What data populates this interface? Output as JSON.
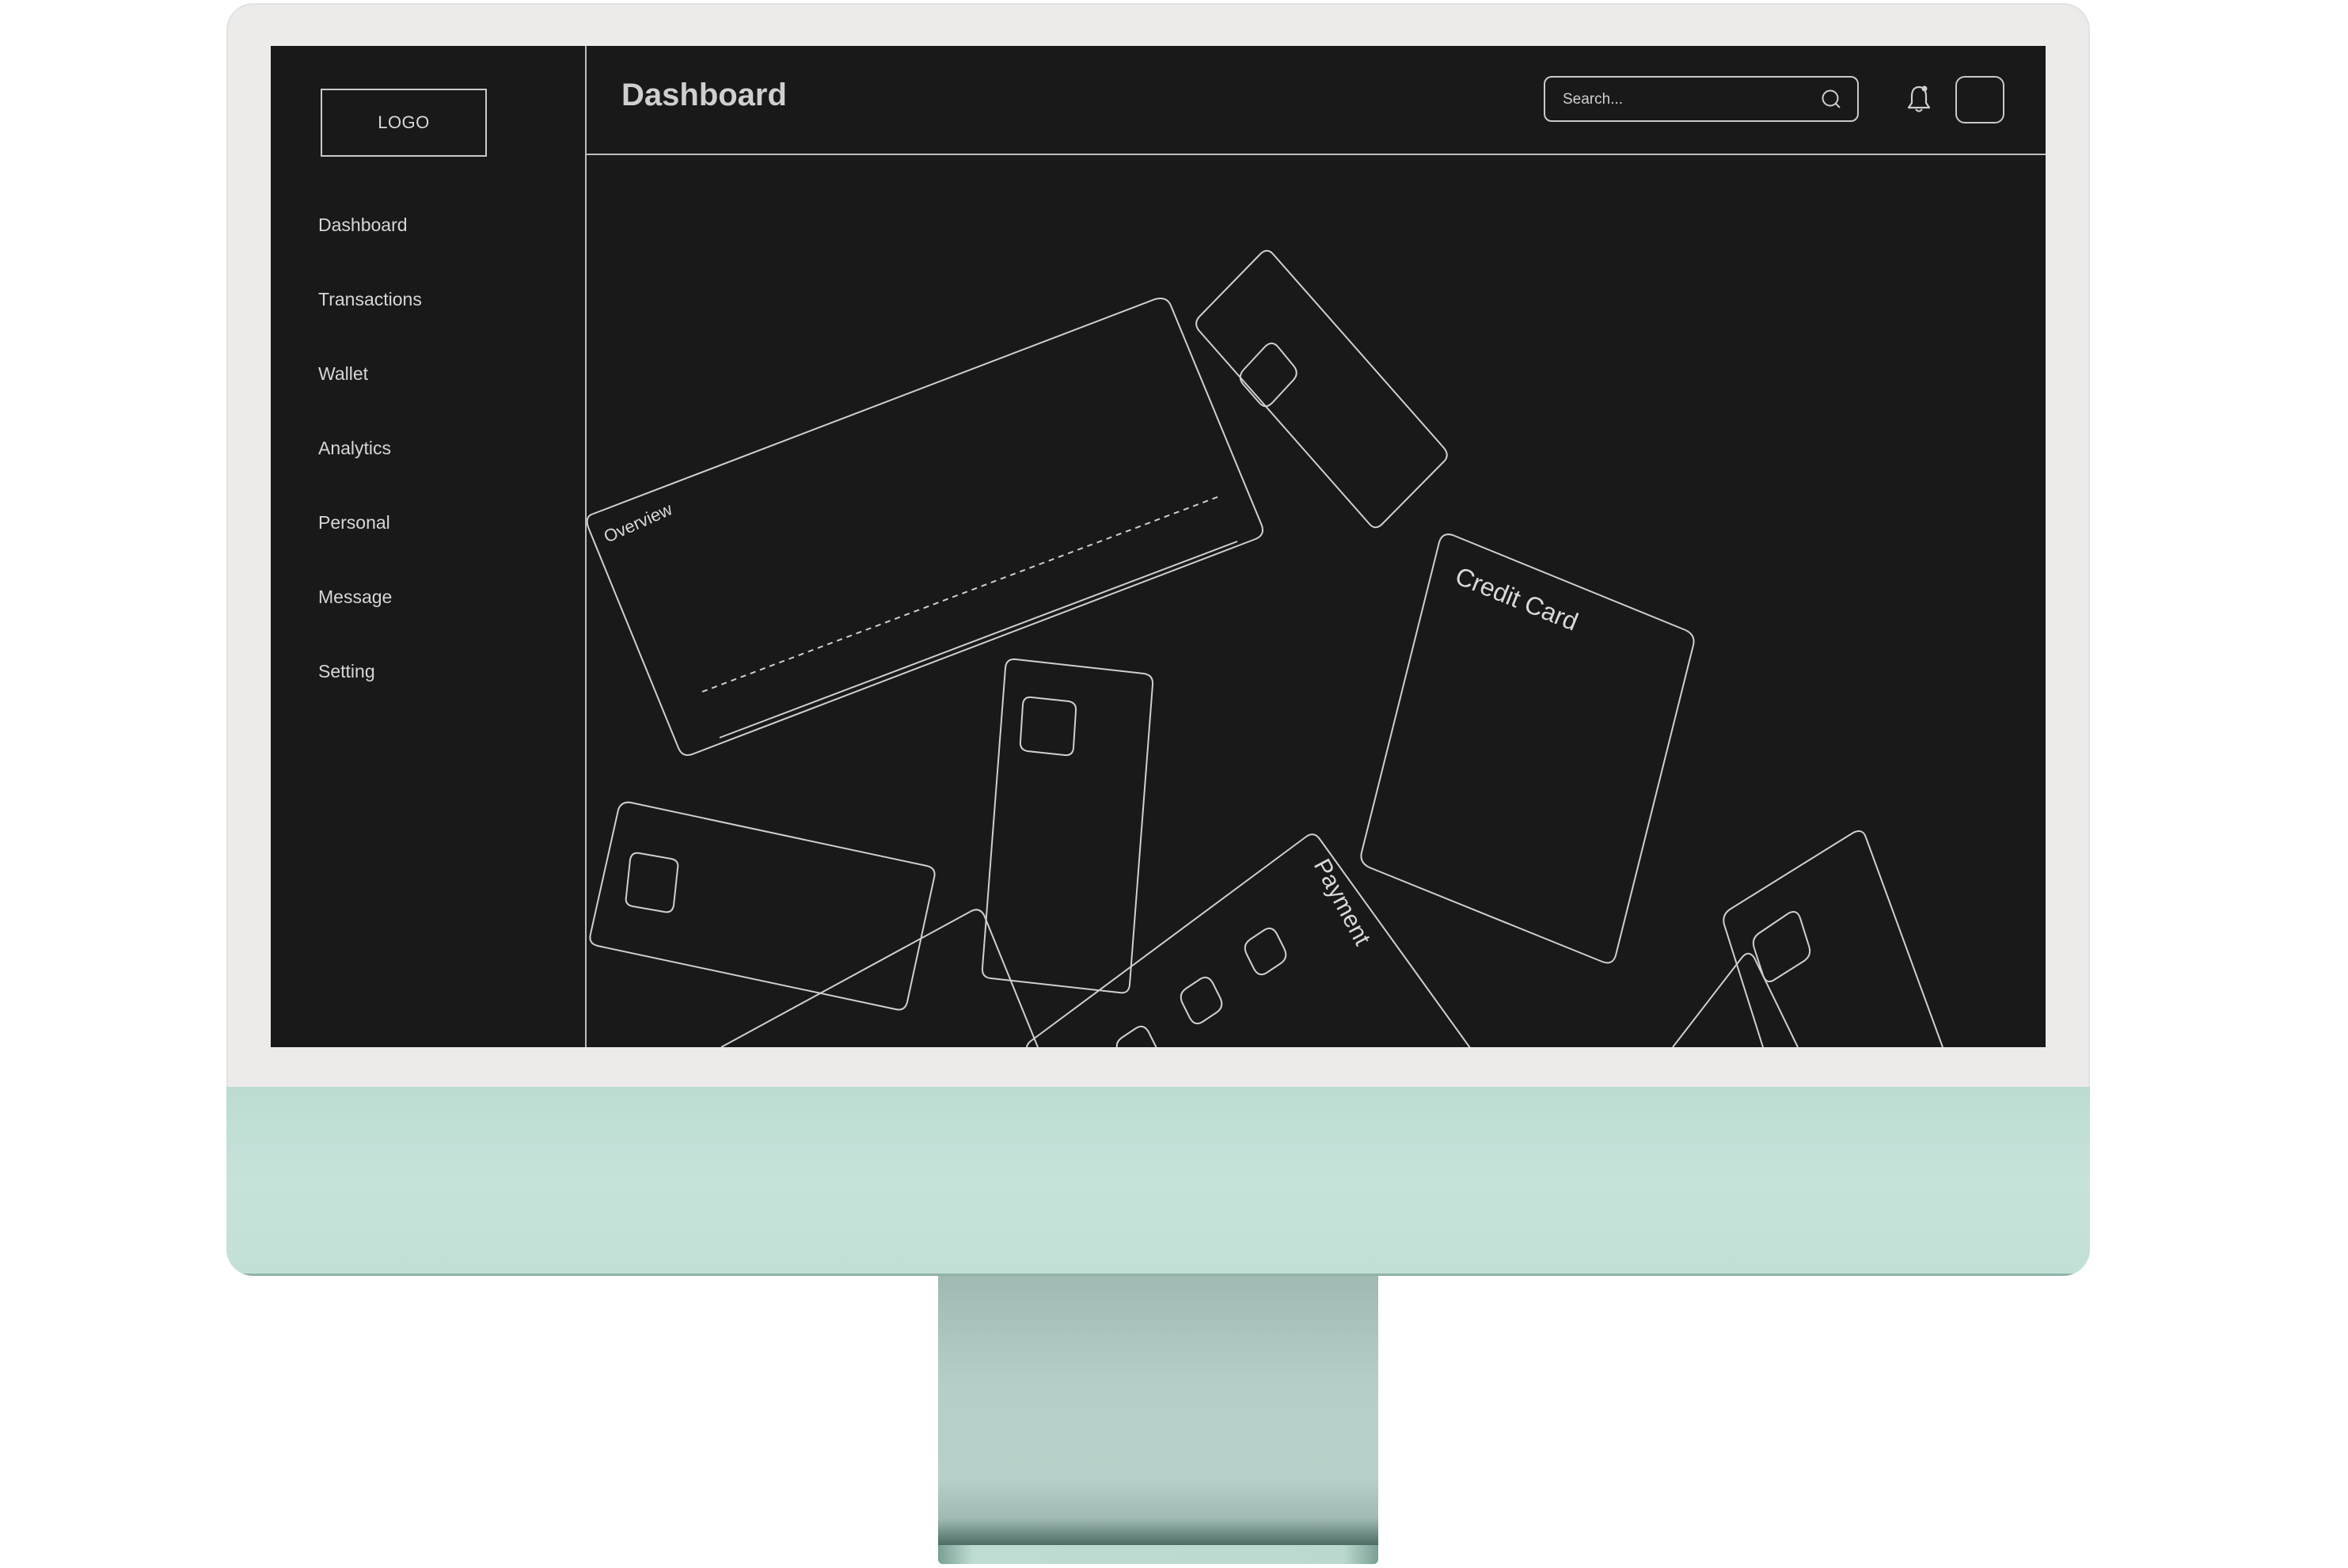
{
  "logo": {
    "label": "LOGO"
  },
  "sidebar": {
    "items": [
      {
        "label": "Dashboard"
      },
      {
        "label": "Transactions"
      },
      {
        "label": "Wallet"
      },
      {
        "label": "Analytics"
      },
      {
        "label": "Personal"
      },
      {
        "label": "Message"
      },
      {
        "label": "Setting"
      }
    ]
  },
  "header": {
    "title": "Dashboard",
    "search": {
      "placeholder": "Search...",
      "value": ""
    },
    "icons": {
      "search": "search-icon",
      "notifications": "bell-icon",
      "profile": "avatar"
    }
  },
  "cards": {
    "overview": "Overview",
    "credit_card": "Credit Card",
    "payment": "Payment"
  },
  "colors": {
    "screen_bg": "#191919",
    "line": "#cfcfcf",
    "bezel": "#ecebea",
    "chin": "#c4e2d9",
    "stand": "#b3cfc7"
  }
}
